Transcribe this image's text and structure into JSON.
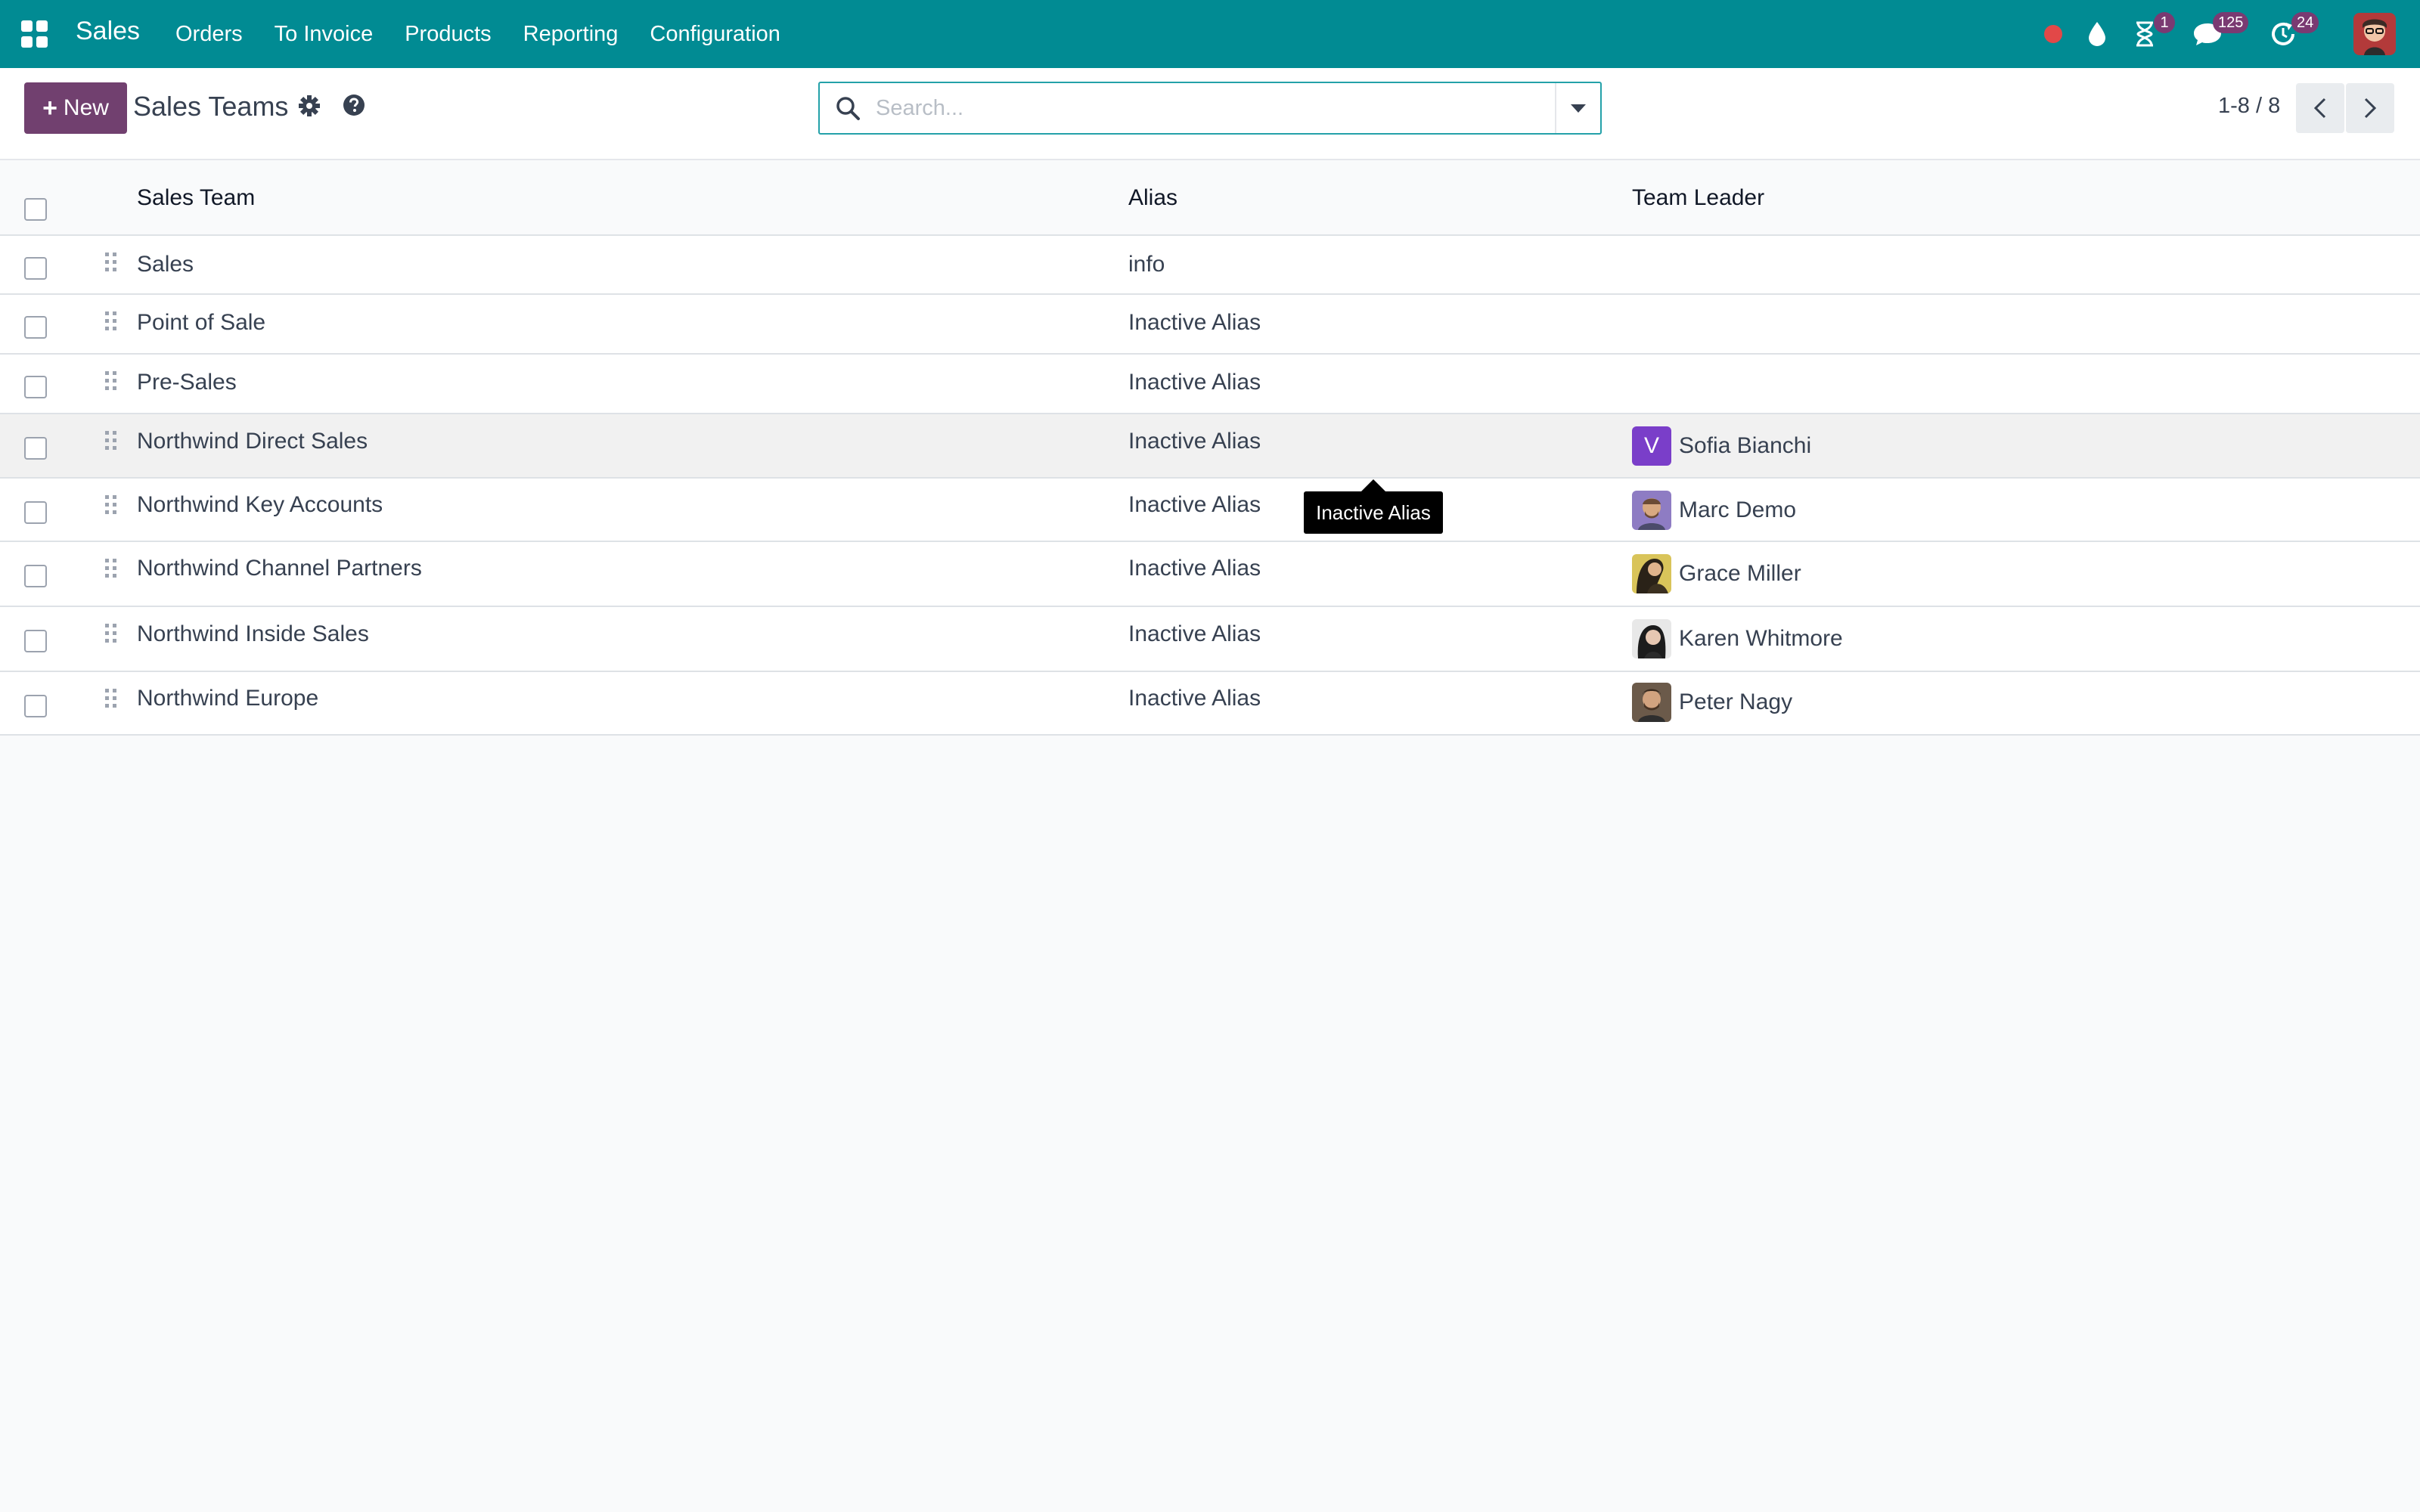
{
  "navbar": {
    "brand": "Sales",
    "menu": [
      {
        "label": "Orders"
      },
      {
        "label": "To Invoice"
      },
      {
        "label": "Products"
      },
      {
        "label": "Reporting"
      },
      {
        "label": "Configuration"
      }
    ],
    "systray": {
      "activities_count": "1",
      "messages_count": "125",
      "updates_count": "24"
    }
  },
  "control_panel": {
    "new_label": "New",
    "title": "Sales Teams",
    "search": {
      "placeholder": "Search..."
    },
    "pager": {
      "value": "1-8 / 8"
    }
  },
  "list": {
    "columns": [
      "Sales Team",
      "Alias",
      "Team Leader"
    ],
    "rows": [
      {
        "team": "Sales",
        "alias": "info",
        "leader": ""
      },
      {
        "team": "Point of Sale",
        "alias": "Inactive Alias",
        "leader": ""
      },
      {
        "team": "Pre-Sales",
        "alias": "Inactive Alias",
        "leader": ""
      },
      {
        "team": "Northwind Direct Sales",
        "alias": "Inactive Alias",
        "leader": "Sofia Bianchi",
        "leader_initial": "V"
      },
      {
        "team": "Northwind Key Accounts",
        "alias": "Inactive Alias",
        "leader": "Marc Demo"
      },
      {
        "team": "Northwind Channel Partners",
        "alias": "Inactive Alias",
        "leader": "Grace Miller"
      },
      {
        "team": "Northwind Inside Sales",
        "alias": "Inactive Alias",
        "leader": "Karen Whitmore"
      },
      {
        "team": "Northwind Europe",
        "alias": "Inactive Alias",
        "leader": "Peter Nagy"
      }
    ]
  },
  "tooltip": {
    "text": "Inactive Alias"
  },
  "colors": {
    "navbar": "#018b93",
    "primary_button": "#71406f",
    "badge": "#7a3a72",
    "recording_dot": "#e24848",
    "avatar_letter_bg": "#7a3ec9"
  }
}
